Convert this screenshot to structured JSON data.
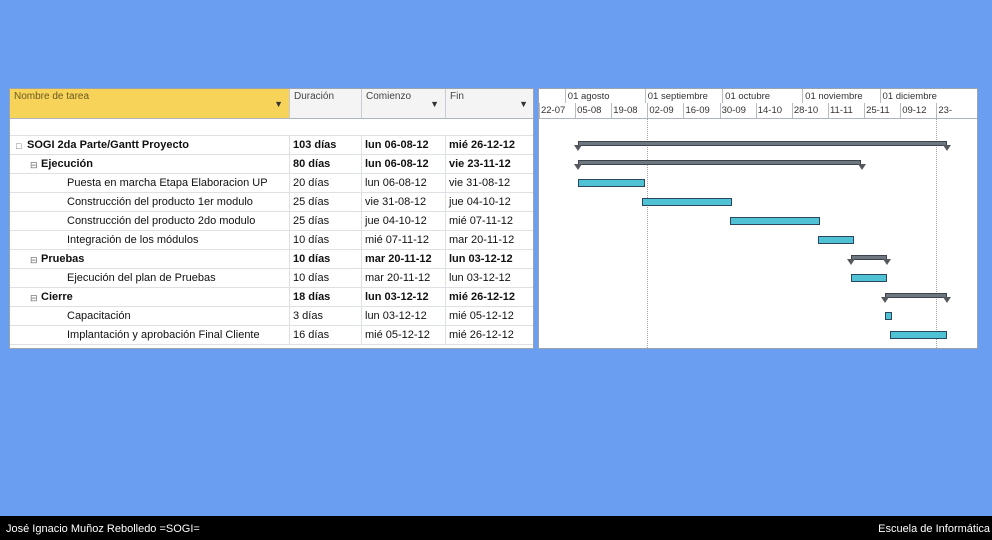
{
  "table": {
    "columns": [
      {
        "label": "Nombre de tarea",
        "active": true
      },
      {
        "label": "Duración",
        "active": false
      },
      {
        "label": "Comienzo",
        "active": false
      },
      {
        "label": "Fin",
        "active": false
      }
    ],
    "rows": [
      {
        "name": "SOGI 2da Parte/Gantt Proyecto",
        "duration": "103 días",
        "start": "lun 06-08-12",
        "end": "mié 26-12-12",
        "level": 0,
        "bold": true,
        "toggle": "□"
      },
      {
        "name": "Ejecución",
        "duration": "80 días",
        "start": "lun 06-08-12",
        "end": "vie 23-11-12",
        "level": 1,
        "bold": true,
        "toggle": "⊟"
      },
      {
        "name": "Puesta en marcha Etapa Elaboracion UP",
        "duration": "20 días",
        "start": "lun 06-08-12",
        "end": "vie 31-08-12",
        "level": 2,
        "bold": false
      },
      {
        "name": "Construcción del producto 1er modulo",
        "duration": "25 días",
        "start": "vie 31-08-12",
        "end": "jue 04-10-12",
        "level": 2,
        "bold": false
      },
      {
        "name": "Construcción del producto 2do modulo",
        "duration": "25 días",
        "start": "jue 04-10-12",
        "end": "mié 07-11-12",
        "level": 2,
        "bold": false
      },
      {
        "name": "Integración de los módulos",
        "duration": "10 días",
        "start": "mié 07-11-12",
        "end": "mar 20-11-12",
        "level": 2,
        "bold": false
      },
      {
        "name": "Pruebas",
        "duration": "10 días",
        "start": "mar 20-11-12",
        "end": "lun 03-12-12",
        "level": 1,
        "bold": true,
        "toggle": "⊟"
      },
      {
        "name": "Ejecución del plan de Pruebas",
        "duration": "10 días",
        "start": "mar 20-11-12",
        "end": "lun 03-12-12",
        "level": 2,
        "bold": false
      },
      {
        "name": "Cierre",
        "duration": "18 días",
        "start": "lun 03-12-12",
        "end": "mié 26-12-12",
        "level": 1,
        "bold": true,
        "toggle": "⊟"
      },
      {
        "name": "Capacitación",
        "duration": "3 días",
        "start": "lun 03-12-12",
        "end": "mié 05-12-12",
        "level": 2,
        "bold": false
      },
      {
        "name": "Implantación y aprobación Final Cliente",
        "duration": "16 días",
        "start": "mié 05-12-12",
        "end": "mié 26-12-12",
        "level": 2,
        "bold": false
      }
    ]
  },
  "timescale": {
    "months": [
      "01 agosto",
      "01 septiembre",
      "01 octubre",
      "01 noviembre",
      "01 diciembre"
    ],
    "weeks": [
      "22-07",
      "05-08",
      "19-08",
      "02-09",
      "16-09",
      "30-09",
      "14-10",
      "28-10",
      "11-11",
      "25-11",
      "09-12",
      "23-"
    ]
  },
  "footer": {
    "left": "José Ignacio Muñoz Rebolledo =SOGI=",
    "right": "Escuela de Informática"
  },
  "colors": {
    "background": "#6a9ef0",
    "active_header": "#f7d35a",
    "task_bar": "#4fc3d4",
    "summary_bar": "#6e7680"
  }
}
